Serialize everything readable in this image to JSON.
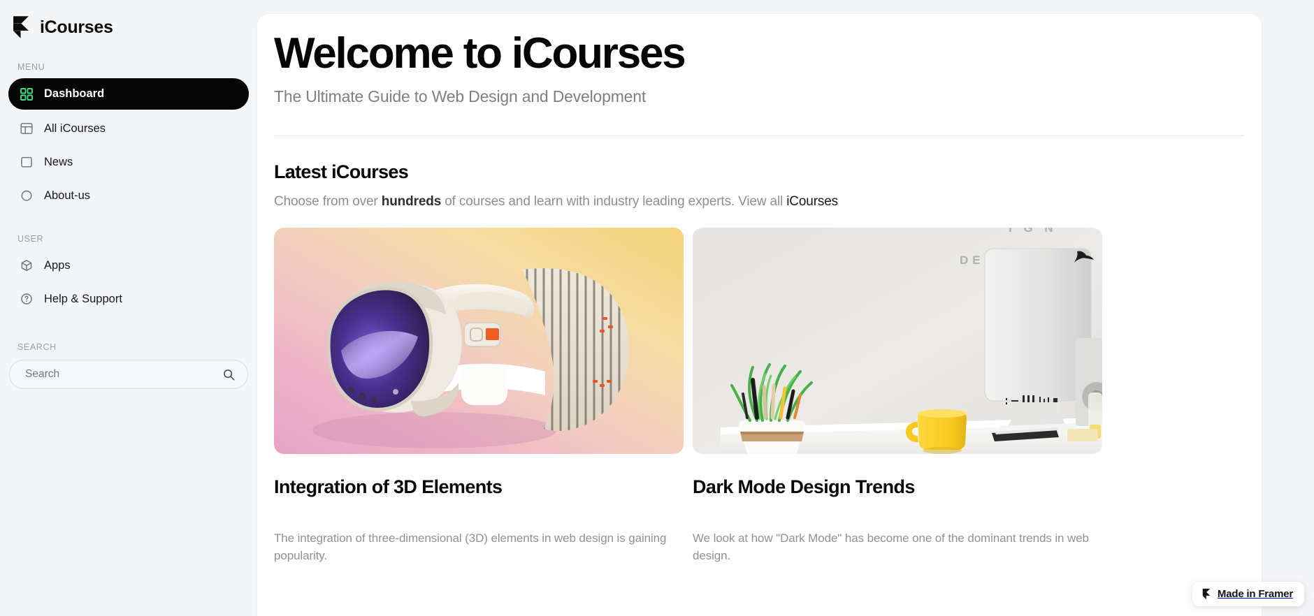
{
  "brand": {
    "name": "iCourses",
    "logo_icon": "framer-logo-icon"
  },
  "sidebar": {
    "sections": [
      {
        "label": "MENU",
        "items": [
          {
            "label": "Dashboard",
            "icon": "grid-icon",
            "active": true
          },
          {
            "label": "All iCourses",
            "icon": "layout-panel-icon",
            "active": false
          },
          {
            "label": "News",
            "icon": "square-icon",
            "active": false
          },
          {
            "label": "About-us",
            "icon": "circle-icon",
            "active": false
          }
        ]
      },
      {
        "label": "USER",
        "items": [
          {
            "label": "Apps",
            "icon": "box-icon",
            "active": false
          },
          {
            "label": "Help & Support",
            "icon": "question-circle-icon",
            "active": false
          }
        ]
      }
    ],
    "search": {
      "label": "SEARCH",
      "placeholder": "Search",
      "value": "",
      "icon": "search-icon"
    }
  },
  "main": {
    "title": "Welcome to iCourses",
    "subtitle": "The Ultimate Guide to Web Design and Development",
    "section": {
      "title": "Latest iCourses",
      "desc_pre": "Choose from over ",
      "desc_bold": "hundreds",
      "desc_mid": " of courses and learn with industry leading experts. View all ",
      "desc_link": "iCourses"
    },
    "cards": [
      {
        "title": "Integration of 3D Elements",
        "desc": "The integration of three-dimensional (3D) elements in web design is gaining popularity.",
        "image_name": "vr-headset-photo"
      },
      {
        "title": "Dark Mode Design Trends",
        "desc": "We look at how \"Dark Mode\" has become one of the dominant trends in web design.",
        "image_name": "desk-workspace-photo"
      }
    ]
  },
  "framer_badge": {
    "label": "Made in Framer",
    "icon": "framer-logo-icon"
  },
  "colors": {
    "accent_green": "#3ddc84",
    "active_bg": "#060607",
    "page_bg": "#f4f5f7",
    "panel_bg": "#ffffff",
    "muted_text": "#8b8f94"
  }
}
